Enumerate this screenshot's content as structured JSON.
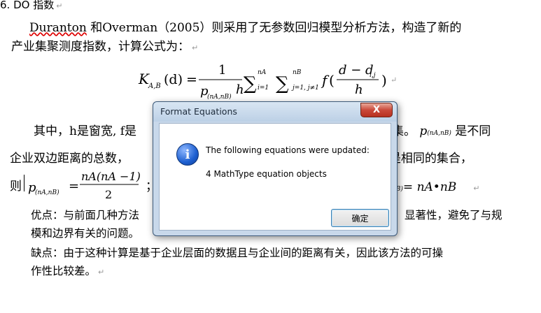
{
  "doc": {
    "heading": "6. DO 指数",
    "p1_author": "Duranton",
    "p1_text": " 和Overman（2005）则采用了无参数回归模型分析方法，构造了新的",
    "p2": "产业集聚测度指数，计算公式为：",
    "p3": "其中，h是窗宽, f是",
    "p3_right": "集。",
    "p3_right2": "是不同",
    "p4": "企业双边距离的总数，",
    "p4_right": "B 是相同的集合，",
    "p5": "则",
    "p5_mid": "；",
    "p6": "优点：与前面几种方法",
    "p6_right": "显著性，避免了与规",
    "p7": "模和边界有关的问题。",
    "p8": "缺点：由于这种计算是基于企业层面的数据且与企业间的距离有关，因此该方法的可操",
    "p9": "作性比较差。",
    "para_mark": "↵",
    "formula": {
      "lhs": "K",
      "lhs_sub": "A,B",
      "lhs_arg": "(d)",
      "eq": "=",
      "num1": "1",
      "den1_p": "p",
      "den1_sub": "(nA,nB)",
      "den1_h": "h",
      "sum1_top": "nA",
      "sum1_bot": "i=1",
      "sum2_top": "nB",
      "sum2_bot": "j=1, j≠1",
      "f": "f",
      "num2": "d − d",
      "num2_sub": "i,j",
      "den2": "h",
      "paren_open": "(",
      "paren_close": ")"
    },
    "formula2": {
      "p": "p",
      "sub": "(nA,nB)",
      "eq": "=",
      "num": "nA(nA −1)",
      "den": "2"
    },
    "formula3": "= nA•nB",
    "p_inline": "p",
    "p_inline_sub": "(nA,nB)",
    "p_inline3_sub": "nB)"
  },
  "dialog": {
    "title": "Format Equations",
    "close_glyph": "X",
    "info_glyph": "i",
    "message_line1": "The following equations were updated:",
    "message_line2": "4  MathType equation objects",
    "ok_label": "确定"
  }
}
